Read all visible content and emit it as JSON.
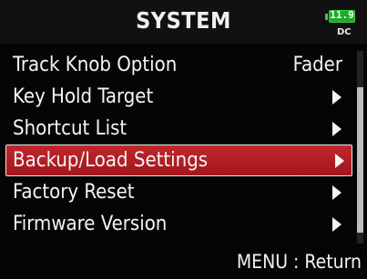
{
  "header": {
    "title": "SYSTEM",
    "battery_level": "11.9",
    "power_source": "DC"
  },
  "menu": {
    "items": [
      {
        "label": "Track Knob Option",
        "value": "Fader",
        "has_arrow": false
      },
      {
        "label": "Key Hold Target",
        "value": "",
        "has_arrow": true
      },
      {
        "label": "Shortcut List",
        "value": "",
        "has_arrow": true
      },
      {
        "label": "Backup/Load Settings",
        "value": "",
        "has_arrow": true,
        "selected": true
      },
      {
        "label": "Factory Reset",
        "value": "",
        "has_arrow": true
      },
      {
        "label": "Firmware Version",
        "value": "",
        "has_arrow": true
      }
    ]
  },
  "footer": {
    "hint": "MENU : Return"
  },
  "colors": {
    "selected_row": "#b81f25",
    "battery": "#1fa82a",
    "background": "#050505"
  }
}
